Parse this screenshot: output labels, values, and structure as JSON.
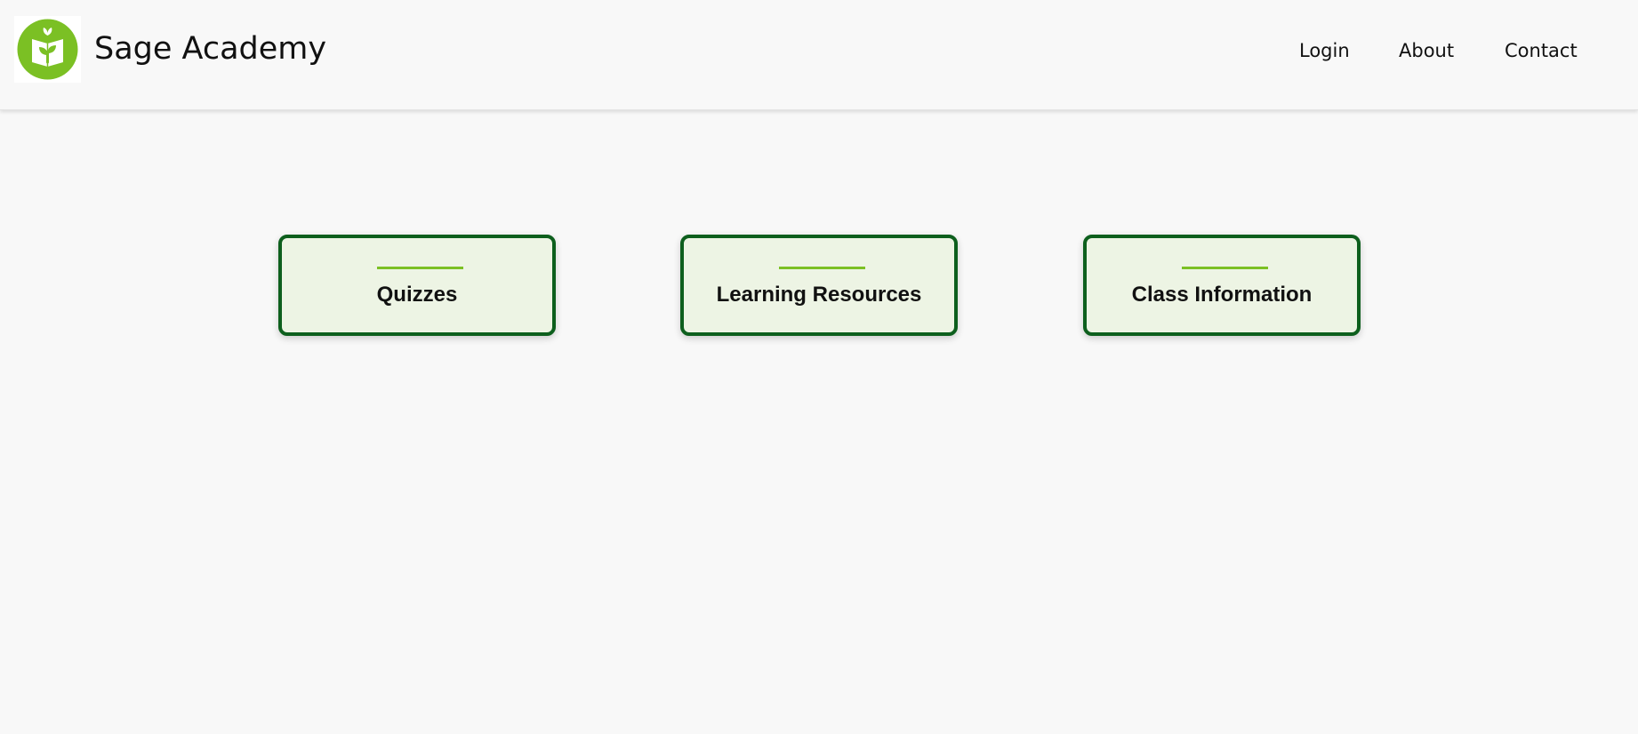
{
  "header": {
    "brand": "Sage Academy",
    "logo_icon": "book-sprout-icon",
    "nav": [
      {
        "label": "Login"
      },
      {
        "label": "About"
      },
      {
        "label": "Contact"
      }
    ]
  },
  "cards": [
    {
      "title": "Quizzes"
    },
    {
      "title": "Learning Resources"
    },
    {
      "title": "Class Information"
    }
  ],
  "colors": {
    "background": "#f8f8f8",
    "logo_green": "#7bc024",
    "card_border": "#0d5f1d",
    "card_fill": "#edf4e4",
    "accent_rule": "#7bc024"
  }
}
